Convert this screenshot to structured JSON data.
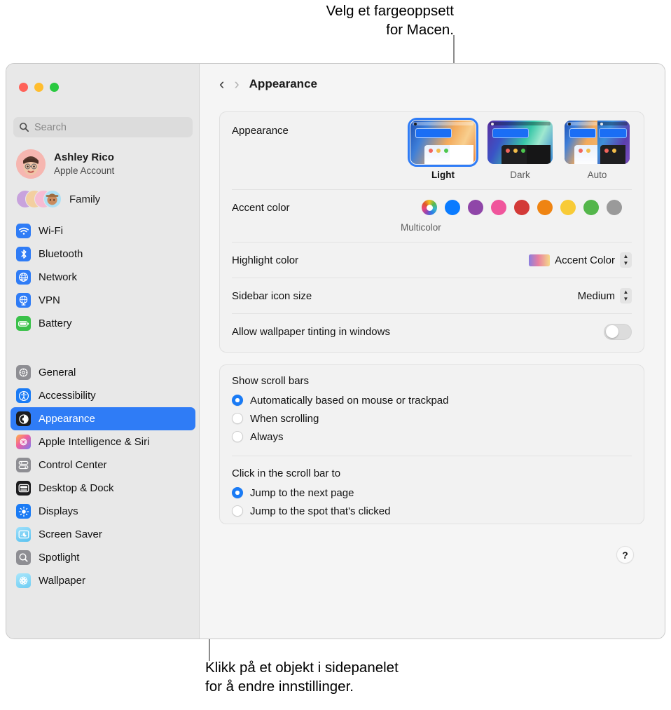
{
  "callouts": {
    "top": "Velg et fargeoppsett\nfor Macen.",
    "bottom": "Klikk på et objekt i sidepanelet\nfor å endre innstillinger."
  },
  "window": {
    "traffic_lights": [
      {
        "name": "close",
        "color": "#ff6259"
      },
      {
        "name": "minimize",
        "color": "#ffbd2e"
      },
      {
        "name": "zoom",
        "color": "#2ac940"
      }
    ]
  },
  "sidebar": {
    "search": {
      "placeholder": "Search",
      "value": "",
      "icon": "search-icon"
    },
    "account": {
      "name": "Ashley Rico",
      "subtitle": "Apple Account",
      "avatar": "memoji-avatar"
    },
    "family": {
      "label": "Family",
      "icon": "family-avatars"
    },
    "group1": [
      {
        "label": "Wi-Fi",
        "icon": "wifi-icon",
        "color": "#2f7cf6"
      },
      {
        "label": "Bluetooth",
        "icon": "bluetooth-icon",
        "color": "#2f7cf6"
      },
      {
        "label": "Network",
        "icon": "globe-icon",
        "color": "#2f7cf6"
      },
      {
        "label": "VPN",
        "icon": "vpn-globe-icon",
        "color": "#2f7cf6"
      },
      {
        "label": "Battery",
        "icon": "battery-icon",
        "color": "#3ac14a"
      }
    ],
    "group2": [
      {
        "label": "General",
        "icon": "gear-icon",
        "color": "#8e8e93",
        "selected": false
      },
      {
        "label": "Accessibility",
        "icon": "accessibility-icon",
        "color": "#1a7bf5",
        "selected": false
      },
      {
        "label": "Appearance",
        "icon": "appearance-contrast-icon",
        "color": "#1c1c1e",
        "selected": true
      },
      {
        "label": "Apple Intelligence & Siri",
        "icon": "siri-icon",
        "color": "#e96fb0",
        "selected": false
      },
      {
        "label": "Control Center",
        "icon": "control-center-icon",
        "color": "#8e8e93",
        "selected": false
      },
      {
        "label": "Desktop & Dock",
        "icon": "desktop-dock-icon",
        "color": "#1c1c1e",
        "selected": false
      },
      {
        "label": "Displays",
        "icon": "displays-brightness-icon",
        "color": "#1a7bf5",
        "selected": false
      },
      {
        "label": "Screen Saver",
        "icon": "screen-saver-icon",
        "color": "#74cdf5",
        "selected": false
      },
      {
        "label": "Spotlight",
        "icon": "spotlight-search-icon",
        "color": "#8e8e93",
        "selected": false
      },
      {
        "label": "Wallpaper",
        "icon": "wallpaper-flower-icon",
        "color": "#7fd4f7",
        "selected": false
      }
    ]
  },
  "detail": {
    "nav": {
      "back": "‹",
      "forward": "›"
    },
    "title": "Appearance",
    "appearance": {
      "label": "Appearance",
      "options": [
        {
          "label": "Light",
          "selected": true
        },
        {
          "label": "Dark",
          "selected": false
        },
        {
          "label": "Auto",
          "selected": false
        }
      ]
    },
    "accent": {
      "label": "Accent color",
      "selected_name": "Multicolor",
      "swatches": [
        {
          "name": "multicolor",
          "color": "multicolor"
        },
        {
          "name": "blue",
          "color": "#0a7bff"
        },
        {
          "name": "purple",
          "color": "#8f46a8"
        },
        {
          "name": "pink",
          "color": "#f0559c"
        },
        {
          "name": "red",
          "color": "#d33a38"
        },
        {
          "name": "orange",
          "color": "#ef8412"
        },
        {
          "name": "yellow",
          "color": "#f8cb37"
        },
        {
          "name": "green",
          "color": "#54b64b"
        },
        {
          "name": "graphite",
          "color": "#9a9a9a"
        }
      ]
    },
    "highlight": {
      "label": "Highlight color",
      "value": "Accent Color"
    },
    "sidebar_icon_size": {
      "label": "Sidebar icon size",
      "value": "Medium"
    },
    "wallpaper_tinting": {
      "label": "Allow wallpaper tinting in windows",
      "value": "off"
    },
    "scroll_bars": {
      "label": "Show scroll bars",
      "options": [
        {
          "label": "Automatically based on mouse or trackpad",
          "selected": true
        },
        {
          "label": "When scrolling",
          "selected": false
        },
        {
          "label": "Always",
          "selected": false
        }
      ]
    },
    "scroll_click": {
      "label": "Click in the scroll bar to",
      "options": [
        {
          "label": "Jump to the next page",
          "selected": true
        },
        {
          "label": "Jump to the spot that's clicked",
          "selected": false
        }
      ]
    },
    "help": {
      "label": "?"
    }
  }
}
